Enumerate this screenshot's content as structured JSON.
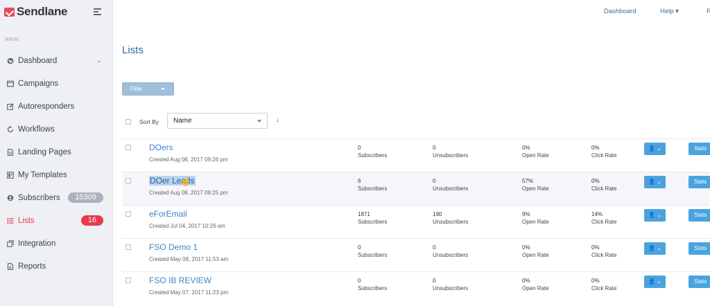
{
  "brand": {
    "name": "Sendlane",
    "accent": "#e8394f"
  },
  "sidebar": {
    "section": "MAIN",
    "items": [
      {
        "label": "Dashboard",
        "icon": "globe-icon",
        "chevron": "⌄"
      },
      {
        "label": "Campaigns",
        "icon": "campaigns-icon"
      },
      {
        "label": "Autoresponders",
        "icon": "edit-icon"
      },
      {
        "label": "Workflows",
        "icon": "workflow-icon"
      },
      {
        "label": "Landing Pages",
        "icon": "page-icon"
      },
      {
        "label": "My Templates",
        "icon": "template-icon"
      },
      {
        "label": "Subscribers",
        "icon": "subscribers-icon",
        "badge": "15309"
      },
      {
        "label": "Lists",
        "icon": "list-icon",
        "badge": "16",
        "active": true
      },
      {
        "label": "Integration",
        "icon": "integration-icon"
      },
      {
        "label": "Reports",
        "icon": "report-icon"
      }
    ]
  },
  "topnav": {
    "dashboard": "Dashboard",
    "help": "Help ▾",
    "extra": "R"
  },
  "main": {
    "title": "Lists",
    "filter_label": "Filter",
    "sort_label": "Sort By",
    "sort_value": "Name",
    "sort_arrow": "↓"
  },
  "lists": [
    {
      "name": "DOers",
      "created": "Created Aug 08, 2017 09:26 pm",
      "subscribers": "0",
      "unsubscribers": "0",
      "open_rate": "0%",
      "click_rate": "0%"
    },
    {
      "name": "DOer Leads",
      "created": "Created Aug 08, 2017 09:25 pm",
      "subscribers": "6",
      "unsubscribers": "0",
      "open_rate": "57%",
      "click_rate": "0%",
      "selected": true
    },
    {
      "name": "eForEmail",
      "created": "Created Jul 04, 2017 10:26 am",
      "subscribers": "1871",
      "unsubscribers": "190",
      "open_rate": "9%",
      "click_rate": "14%"
    },
    {
      "name": "FSO Demo 1",
      "created": "Created May 08, 2017 11:53 am",
      "subscribers": "0",
      "unsubscribers": "0",
      "open_rate": "0%",
      "click_rate": "0%"
    },
    {
      "name": "FSO IB REVIEW",
      "created": "Created May 07, 2017 11:23 pm",
      "subscribers": "0",
      "unsubscribers": "0",
      "open_rate": "0%",
      "click_rate": "0%"
    }
  ],
  "labels": {
    "subscribers": "Subscribers",
    "unsubscribers": "Unsubscribers",
    "open_rate": "Open Rate",
    "click_rate": "Click Rate",
    "action_button": "👤 ⌄",
    "stats_button": "Stats"
  }
}
